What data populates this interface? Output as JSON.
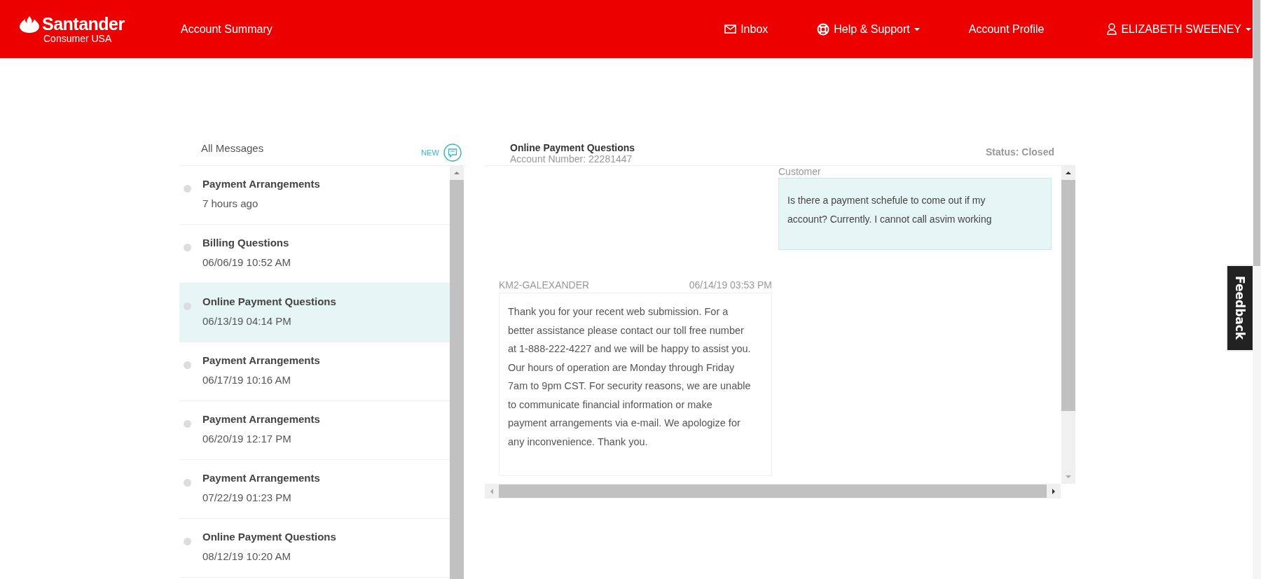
{
  "header": {
    "logo": {
      "name": "Santander",
      "sub": "Consumer USA"
    },
    "nav": [
      {
        "label": "Account Summary",
        "kind": "plain",
        "dropdown": false
      },
      {
        "label": "Inbox",
        "kind": "mail",
        "dropdown": false
      },
      {
        "label": "Help & Support",
        "kind": "help",
        "dropdown": true
      },
      {
        "label": "Account Profile",
        "kind": "plain",
        "dropdown": false
      },
      {
        "label": "ELIZABETH SWEENEY",
        "kind": "user",
        "dropdown": true
      }
    ]
  },
  "inbox": {
    "title": "All Messages",
    "new_label": "NEW",
    "items": [
      {
        "title": "Payment Arrangements",
        "time": "7 hours ago",
        "selected": false
      },
      {
        "title": "Billing Questions",
        "time": "06/06/19 10:52 AM",
        "selected": false
      },
      {
        "title": "Online Payment Questions",
        "time": "06/13/19 04:14 PM",
        "selected": true
      },
      {
        "title": "Payment Arrangements",
        "time": "06/17/19 10:16 AM",
        "selected": false
      },
      {
        "title": "Payment Arrangements",
        "time": "06/20/19 12:17 PM",
        "selected": false
      },
      {
        "title": "Payment Arrangements",
        "time": "07/22/19 01:23 PM",
        "selected": false
      },
      {
        "title": "Online Payment Questions",
        "time": "08/12/19 10:20 AM",
        "selected": false
      }
    ]
  },
  "conversation": {
    "title": "Online Payment Questions",
    "account": "Account Number: 22281447",
    "status": "Status: Closed",
    "messages": [
      {
        "kind": "customer",
        "author": "Customer",
        "text": "Is there a payment schefule to come out if my account? Currently. I cannot call asvim working"
      },
      {
        "kind": "agent",
        "author": "KM2-GALEXANDER",
        "time": "06/14/19 03:53 PM",
        "text": "Thank you for your recent web submission. For a better assistance please contact our toll free number at 1-888-222-4227 and we will be happy to assist you. Our hours of operation are Monday through Friday 7am to 9pm CST. For security reasons, we are unable to communicate financial information or make payment arrangements via e-mail. We apologize for any inconvenience. Thank you."
      }
    ]
  },
  "feedback": {
    "label": "Feedback"
  }
}
